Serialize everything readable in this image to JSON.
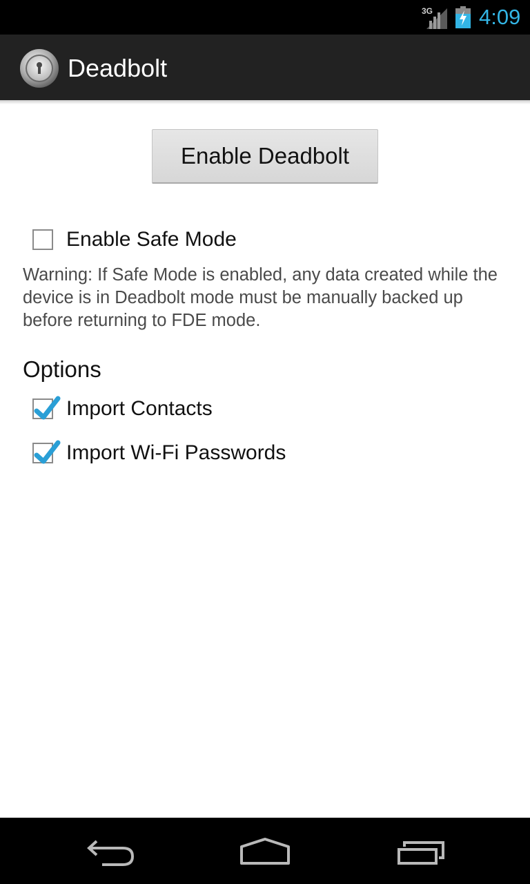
{
  "status_bar": {
    "network_type": "3G",
    "time": "4:09",
    "signal_icon": "signal-bars-icon",
    "battery_icon": "battery-charging-icon",
    "clock_color": "#33b5e5"
  },
  "action_bar": {
    "title": "Deadbolt",
    "icon": "deadbolt-lock-icon",
    "background": "#222222"
  },
  "main": {
    "enable_button_label": "Enable Deadbolt",
    "safe_mode": {
      "label": "Enable Safe Mode",
      "checked": false
    },
    "warning_text": "Warning: If Safe Mode is enabled, any data created while the device is in Deadbolt mode must be manually backed up before returning to FDE mode.",
    "options_heading": "Options",
    "options": [
      {
        "label": "Import Contacts",
        "checked": true
      },
      {
        "label": "Import Wi-Fi Passwords",
        "checked": true
      }
    ],
    "checkmark_color": "#2a9fd6"
  },
  "nav_bar": {
    "back_icon": "back-arrow-icon",
    "home_icon": "home-icon",
    "recents_icon": "recent-apps-icon"
  }
}
